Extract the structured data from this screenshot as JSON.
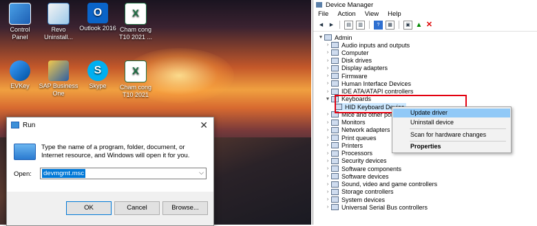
{
  "desktop": {
    "icons": [
      {
        "label_1": "Control",
        "label_2": "Panel",
        "icon": "control-panel-icon"
      },
      {
        "label_1": "Revo",
        "label_2": "Uninstall...",
        "icon": "revo-uninstaller-icon"
      },
      {
        "label_1": "Outlook 2016",
        "label_2": "",
        "icon": "outlook-icon"
      },
      {
        "label_1": "Cham cong",
        "label_2": "T10 2021 ...",
        "icon": "excel-file-icon"
      },
      {
        "label_1": "EVKey",
        "label_2": "",
        "icon": "evkey-icon"
      },
      {
        "label_1": "SAP Business",
        "label_2": "One",
        "icon": "sap-business-one-icon"
      },
      {
        "label_1": "Skype",
        "label_2": "",
        "icon": "skype-icon"
      },
      {
        "label_1": "Cham cong",
        "label_2": "T10 2021",
        "icon": "excel-file-icon"
      }
    ]
  },
  "run_dialog": {
    "title": "Run",
    "message": "Type the name of a program, folder, document, or Internet resource, and Windows will open it for you.",
    "open_label": "Open:",
    "open_value": "devmgmt.msc",
    "ok_label": "OK",
    "cancel_label": "Cancel",
    "browse_label": "Browse..."
  },
  "device_manager": {
    "title": "Device Manager",
    "menu": [
      "File",
      "Action",
      "View",
      "Help"
    ],
    "root": "Admin",
    "tree": [
      {
        "label": "Audio inputs and outputs",
        "expanded": false
      },
      {
        "label": "Computer",
        "expanded": false
      },
      {
        "label": "Disk drives",
        "expanded": false
      },
      {
        "label": "Display adapters",
        "expanded": false
      },
      {
        "label": "Firmware",
        "expanded": false
      },
      {
        "label": "Human Interface Devices",
        "expanded": false
      },
      {
        "label": "IDE ATA/ATAPI controllers",
        "expanded": false
      },
      {
        "label": "Keyboards",
        "expanded": true
      },
      {
        "label": "HID Keyboard Device",
        "child": true,
        "selected": true
      },
      {
        "label": "Mice and other pointing devices",
        "expanded": false
      },
      {
        "label": "Monitors",
        "expanded": false
      },
      {
        "label": "Network adapters",
        "expanded": false
      },
      {
        "label": "Print queues",
        "expanded": false
      },
      {
        "label": "Printers",
        "expanded": false
      },
      {
        "label": "Processors",
        "expanded": false
      },
      {
        "label": "Security devices",
        "expanded": false
      },
      {
        "label": "Software components",
        "expanded": false
      },
      {
        "label": "Software devices",
        "expanded": false
      },
      {
        "label": "Sound, video and game controllers",
        "expanded": false
      },
      {
        "label": "Storage controllers",
        "expanded": false
      },
      {
        "label": "System devices",
        "expanded": false
      },
      {
        "label": "Universal Serial Bus controllers",
        "expanded": false
      }
    ]
  },
  "context_menu": {
    "update_driver": "Update driver",
    "uninstall_device": "Uninstall device",
    "scan_hardware": "Scan for hardware changes",
    "properties": "Properties"
  },
  "colors": {
    "highlight_box": "#e3000f",
    "selection": "#0078d7",
    "menu_hover": "#91c9f7"
  }
}
